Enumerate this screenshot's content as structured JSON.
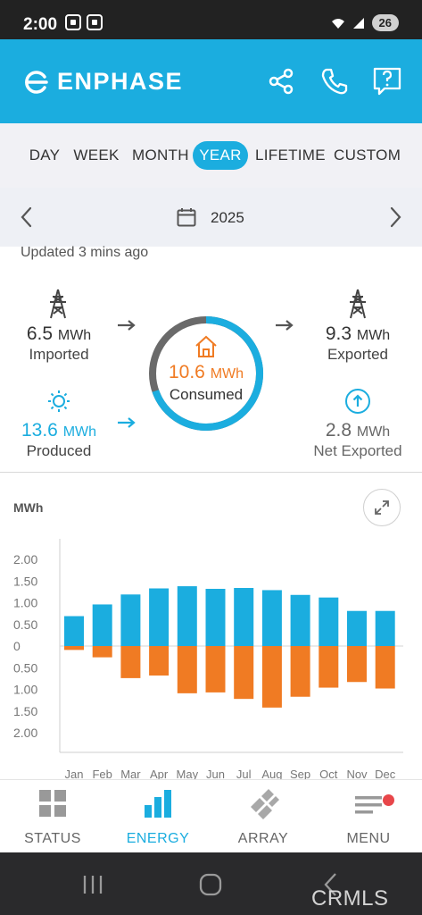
{
  "status_bar": {
    "time": "2:00",
    "battery": "26"
  },
  "app": {
    "brand": "ENPHASE",
    "colors": {
      "accent": "#1baddf",
      "consumed": "#f07b23",
      "status_bar": "#222222"
    }
  },
  "header_icons": [
    "share-icon",
    "phone-icon",
    "help-icon"
  ],
  "period_tabs": [
    "DAY",
    "WEEK",
    "MONTH",
    "YEAR",
    "LIFETIME",
    "CUSTOM"
  ],
  "active_period": "YEAR",
  "date_nav": {
    "label": "2025"
  },
  "updated": "Updated 3 mins ago",
  "summary": {
    "imported": {
      "value": "6.5",
      "unit": "MWh",
      "label": "Imported"
    },
    "exported": {
      "value": "9.3",
      "unit": "MWh",
      "label": "Exported"
    },
    "consumed": {
      "value": "10.6",
      "unit": "MWh",
      "label": "Consumed"
    },
    "produced": {
      "value": "13.6",
      "unit": "MWh",
      "label": "Produced"
    },
    "net_exported": {
      "value": "2.8",
      "unit": "MWh",
      "label": "Net Exported"
    }
  },
  "chart_data": {
    "type": "bar",
    "ylabel": "MWh",
    "categories": [
      "Jan",
      "Feb",
      "Mar",
      "Apr",
      "May",
      "Jun",
      "Jul",
      "Aug",
      "Sep",
      "Oct",
      "Nov",
      "Dec"
    ],
    "ylim": [
      -2.0,
      2.0
    ],
    "y_ticks": [
      "2.00",
      "1.50",
      "1.00",
      "0.50",
      "0",
      "0.50",
      "1.00",
      "1.50",
      "2.00"
    ],
    "grid": false,
    "series": [
      {
        "values": [
          0.69,
          0.96,
          1.19,
          1.33,
          1.38,
          1.32,
          1.34,
          1.29,
          1.18,
          1.12,
          0.81,
          0.81
        ],
        "color": "#1baddf"
      },
      {
        "values": [
          -0.09,
          -0.26,
          -0.74,
          -0.68,
          -1.09,
          -1.07,
          -1.22,
          -1.42,
          -1.17,
          -0.96,
          -0.83,
          -0.98
        ],
        "color": "#f07b23"
      }
    ]
  },
  "bottom_nav": [
    {
      "label": "STATUS"
    },
    {
      "label": "ENERGY"
    },
    {
      "label": "ARRAY"
    },
    {
      "label": "MENU"
    }
  ],
  "active_nav": "ENERGY",
  "watermark": "CRMLS"
}
